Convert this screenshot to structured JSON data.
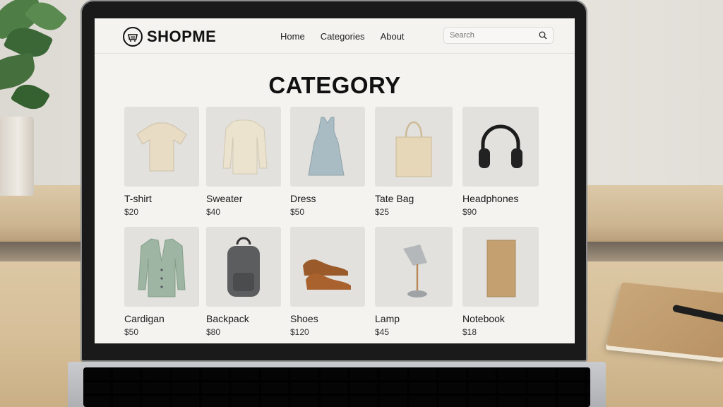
{
  "header": {
    "brand": "SHOPME",
    "logo_icon": "basket-icon",
    "nav": [
      "Home",
      "Categories",
      "About"
    ],
    "search": {
      "placeholder": "Search",
      "icon": "search-icon"
    }
  },
  "page_title": "CATEGORY",
  "products": [
    {
      "name": "T-shirt",
      "price": "$20",
      "icon": "tshirt-icon"
    },
    {
      "name": "Sweater",
      "price": "$40",
      "icon": "sweater-icon"
    },
    {
      "name": "Dress",
      "price": "$50",
      "icon": "dress-icon"
    },
    {
      "name": "Tate Bag",
      "price": "$25",
      "icon": "tote-bag-icon"
    },
    {
      "name": "Headphones",
      "price": "$90",
      "icon": "headphones-icon"
    },
    {
      "name": "Cardigan",
      "price": "$50",
      "icon": "cardigan-icon"
    },
    {
      "name": "Backpack",
      "price": "$80",
      "icon": "backpack-icon"
    },
    {
      "name": "Shoes",
      "price": "$120",
      "icon": "shoes-icon"
    },
    {
      "name": "Lamp",
      "price": "$45",
      "icon": "lamp-icon"
    },
    {
      "name": "Notebook",
      "price": "$18",
      "icon": "notebook-icon"
    }
  ],
  "colors": {
    "screen_bg": "#f4f3f0",
    "thumb_bg": "#e2e1dd",
    "text": "#111111"
  }
}
